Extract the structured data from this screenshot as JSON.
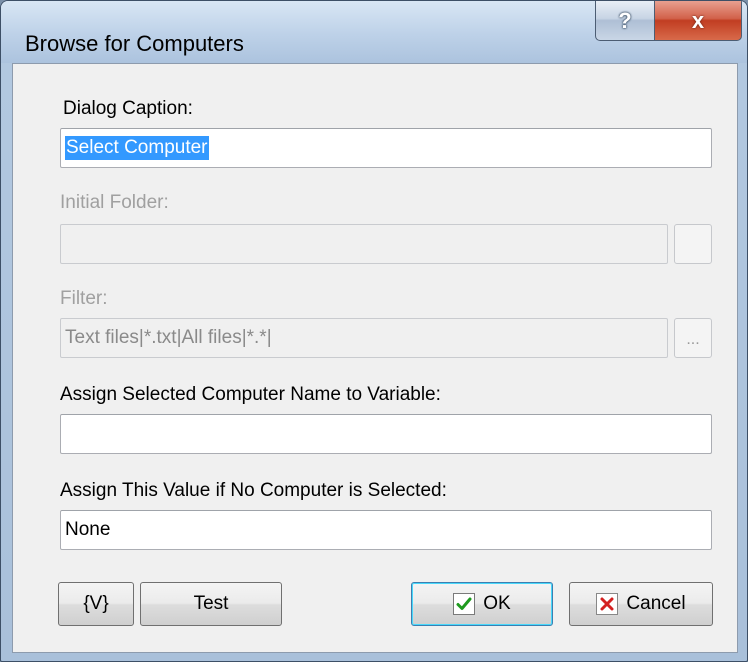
{
  "window": {
    "title": "Browse for Computers",
    "help_glyph": "?",
    "close_glyph": "x"
  },
  "form": {
    "dialog_caption_label": "Dialog Caption:",
    "dialog_caption_value": "Select Computer",
    "initial_folder_label": "Initial Folder:",
    "initial_folder_value": "",
    "filter_label": "Filter:",
    "filter_value": "Text files|*.txt|All files|*.*|",
    "filter_browse_label": "...",
    "assign_variable_label": "Assign Selected Computer Name to Variable:",
    "assign_variable_value": "",
    "no_selection_label": "Assign This Value if No Computer is Selected:",
    "no_selection_value": "None"
  },
  "buttons": {
    "variables_label": "{V}",
    "test_label": "Test",
    "ok_label": "OK",
    "cancel_label": "Cancel"
  },
  "colors": {
    "selection": "#3399ff",
    "ok_check": "#1e9a1e",
    "cancel_x": "#d42020",
    "close_button": "#c13d22"
  }
}
